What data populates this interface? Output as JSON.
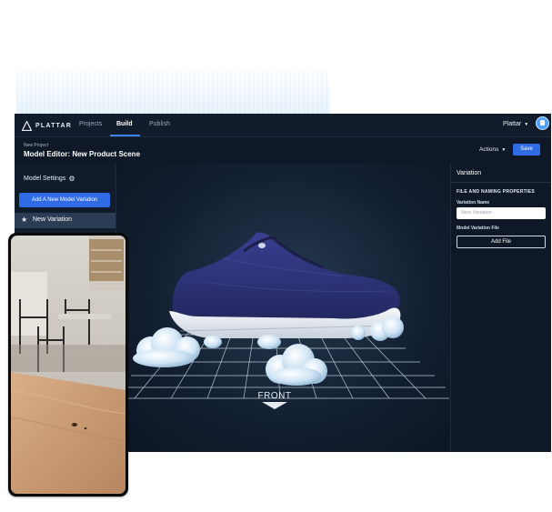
{
  "app": {
    "logo_text": "PLATTAR",
    "nav": [
      "Projects",
      "Build",
      "Publish"
    ],
    "active_nav": "Build",
    "user": "Plattar"
  },
  "header": {
    "breadcrumb": "New Project",
    "title": "Model Editor: New Product Scene",
    "actions_label": "Actions",
    "save_label": "Save"
  },
  "sidebar": {
    "heading": "Model Settings",
    "add_button": "Add A New Model Variation",
    "items": [
      {
        "label": "New Variation"
      }
    ]
  },
  "viewport": {
    "floor_label": "FRONT"
  },
  "panel": {
    "title": "Variation",
    "section": "FILE AND NAMING PROPERTIES",
    "name_label": "Variation Name",
    "name_placeholder": "New Variation",
    "file_label": "Model Variation File",
    "add_file": "Add File"
  },
  "colors": {
    "accent": "#2f6be4",
    "app_bg": "#0f1a2a",
    "shoe": "#2a2f7a",
    "sole": "#e9edf2"
  }
}
